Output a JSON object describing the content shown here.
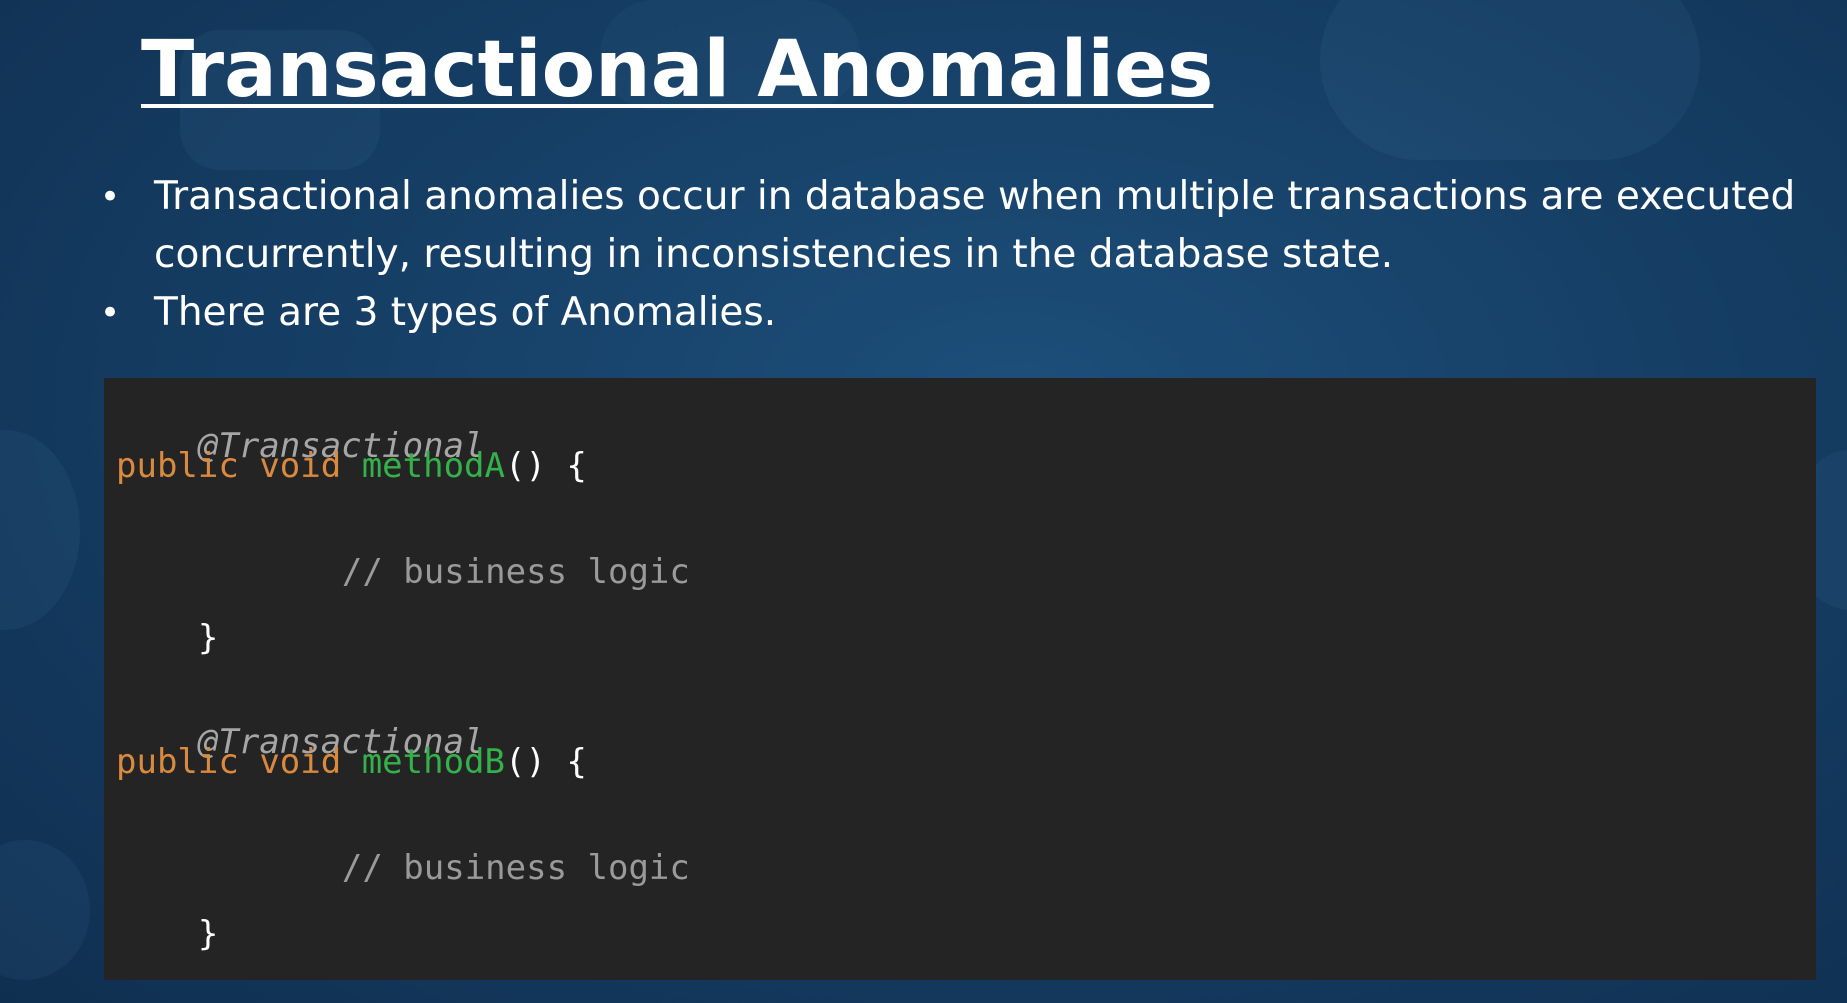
{
  "slide": {
    "title": "Transactional Anomalies",
    "bullets": [
      "Transactional anomalies occur in database when multiple transactions are executed concurrently, resulting in inconsistencies in the database state.",
      "There are 3 types of Anomalies."
    ]
  },
  "code": {
    "blocks": [
      {
        "annotation": "@Transactional",
        "kw_public": "public",
        "kw_void": "void",
        "method": "methodA",
        "signature_tail": "() {",
        "comment": "// business logic",
        "close": "}"
      },
      {
        "annotation": "@Transactional",
        "kw_public": "public",
        "kw_void": "void",
        "method": "methodB",
        "signature_tail": "() {",
        "comment": "// business logic",
        "close": "}"
      }
    ]
  },
  "colors": {
    "background": "#163f66",
    "code_background": "#242424",
    "keyword": "#d98a3e",
    "method_name": "#33b24a",
    "annotation": "#a6a6a6",
    "comment": "#9a9a9a",
    "text": "#ffffff"
  }
}
